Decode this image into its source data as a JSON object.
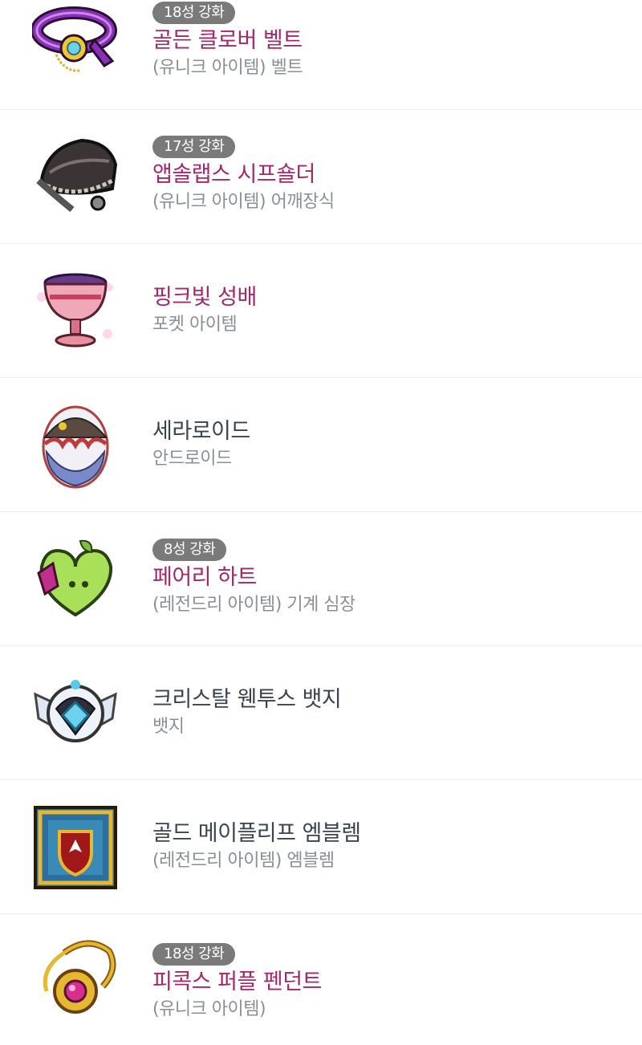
{
  "items": [
    {
      "badge": "18성 강화",
      "name": "골든 클로버 벨트",
      "sub": "(유니크 아이템) 벨트",
      "icon": "belt-icon",
      "name_color": "#a3276c"
    },
    {
      "badge": "17성 강화",
      "name": "앱솔랩스 시프숄더",
      "sub": "(유니크 아이템) 어깨장식",
      "icon": "shoulder-icon",
      "name_color": "#a3276c"
    },
    {
      "badge": "",
      "name": "핑크빛 성배",
      "sub": "포켓 아이템",
      "icon": "goblet-icon",
      "name_color": "#a3276c"
    },
    {
      "badge": "",
      "name": "세라로이드",
      "sub": "안드로이드",
      "icon": "android-egg-icon",
      "name_color": "#3a4350"
    },
    {
      "badge": "8성 강화",
      "name": "페어리 하트",
      "sub": "(레전드리 아이템) 기계 심장",
      "icon": "heart-icon",
      "name_color": "#a3276c"
    },
    {
      "badge": "",
      "name": "크리스탈 웬투스 뱃지",
      "sub": "뱃지",
      "icon": "badge-icon",
      "name_color": "#3a4350"
    },
    {
      "badge": "",
      "name": "골드 메이플리프 엠블렘",
      "sub": "(레전드리 아이템) 엠블렘",
      "icon": "emblem-icon",
      "name_color": "#3a4350"
    },
    {
      "badge": "18성 강화",
      "name": "피콕스 퍼플 펜던트",
      "sub": "(유니크 아이템)",
      "icon": "pendant-icon",
      "name_color": "#a3276c"
    }
  ]
}
